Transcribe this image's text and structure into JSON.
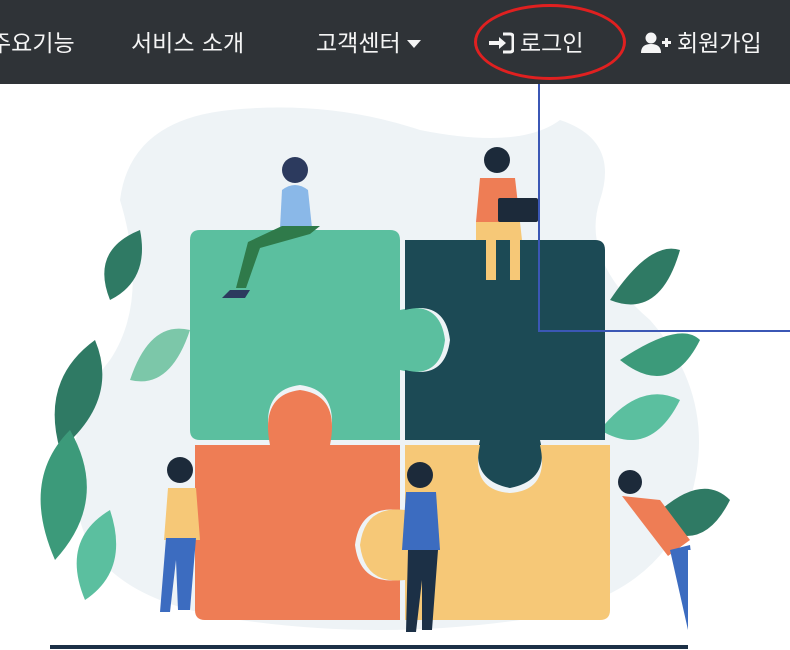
{
  "navbar": {
    "items": [
      {
        "label": "주요기능"
      },
      {
        "label": "서비스 소개"
      },
      {
        "label": "고객센터"
      },
      {
        "label": "로그인"
      },
      {
        "label": "회원가입"
      }
    ]
  },
  "icons": {
    "login": "sign-in-icon",
    "signup": "user-plus-icon",
    "dropdown": "caret-down-icon"
  },
  "colors": {
    "navbar_bg": "#2f3337",
    "nav_text": "#f5f5f5",
    "highlight": "#e02020",
    "annotation": "#3b57b5",
    "puzzle_green": "#5bbf9f",
    "puzzle_dark": "#1c4a55",
    "puzzle_orange": "#ee7d55",
    "puzzle_yellow": "#f6c877"
  },
  "hero": {
    "illustration": "teamwork-puzzle-illustration"
  }
}
